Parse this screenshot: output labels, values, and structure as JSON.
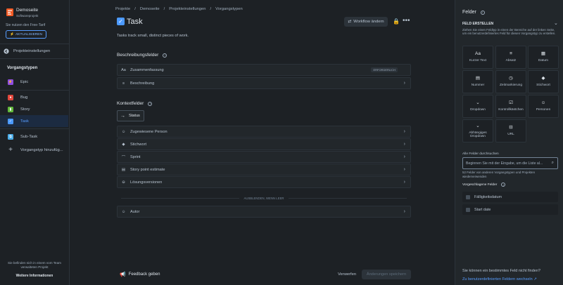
{
  "sidebar": {
    "project_name": "Demoseite",
    "project_type": "Softwareprojekt",
    "plan_notice": "Sie nutzen den Free-Tarif",
    "upgrade_label": "AKTUALISIEREN",
    "back_label": "Projekteinstellungen",
    "section_title": "Vorgangstypen",
    "items": [
      {
        "label": "Epic",
        "color": "#904ee2"
      },
      {
        "label": "Bug",
        "color": "#e2483d"
      },
      {
        "label": "Story",
        "color": "#63ba3c"
      },
      {
        "label": "Task",
        "color": "#4c9aff"
      },
      {
        "label": "Sub-Task",
        "color": "#4bade8"
      },
      {
        "label": "Vorgangstyp hinzufüg..."
      }
    ],
    "footer_text": "Sie befinden sich in einem vom Team verwalteten Projekt",
    "footer_link": "Weitere Informationen"
  },
  "breadcrumb": [
    "Projekte",
    "Demoseite",
    "Projekteinstellungen",
    "Vorgangstypen"
  ],
  "issue": {
    "title": "Task",
    "description": "Tasks track small, distinct pieces of work.",
    "workflow_button": "Workflow ändern"
  },
  "description_fields": {
    "title": "Beschreibungsfelder",
    "fields": [
      {
        "label": "Zusammenfassung",
        "badge": "ERFORDERLICH",
        "icon": "text-icon"
      },
      {
        "label": "Beschreibung",
        "icon": "paragraph-icon"
      }
    ]
  },
  "context_fields": {
    "title": "Kontextfelder",
    "status_label": "Status",
    "fields": [
      {
        "label": "Zugewiesene Person",
        "icon": "person-icon"
      },
      {
        "label": "Stichwort",
        "icon": "tag-icon"
      },
      {
        "label": "Sprint",
        "icon": "sprint-icon"
      },
      {
        "label": "Story point estimate",
        "icon": "number-icon"
      },
      {
        "label": "Lösungsversionen",
        "icon": "version-icon"
      }
    ],
    "hidden_divider": "AUSBLENDEN, WENN LEER",
    "hidden_fields": [
      {
        "label": "Autor",
        "icon": "person-icon"
      }
    ]
  },
  "footer": {
    "feedback": "Feedback geben",
    "discard": "Verwerfen",
    "save": "Änderungen speichern"
  },
  "right_panel": {
    "title": "Felder",
    "create_header": "FELD ERSTELLEN",
    "create_help": "Ziehen Sie einen Feldtyp in einen der Bereiche auf der linken Seite, um ein benutzerdefiniertes Feld für diesen Vorgangstyp zu erstellen.",
    "field_types": [
      {
        "label": "Kurzer Text",
        "icon": "Aa"
      },
      {
        "label": "Absatz",
        "icon": "≡"
      },
      {
        "label": "Datum",
        "icon": "▦"
      },
      {
        "label": "Nummer",
        "icon": "▤"
      },
      {
        "label": "Zeitmarkierung",
        "icon": "◷"
      },
      {
        "label": "Stichwort",
        "icon": "◆"
      },
      {
        "label": "Dropdown",
        "icon": "⌄"
      },
      {
        "label": "Kontrollkästchen",
        "icon": "☑"
      },
      {
        "label": "Personen",
        "icon": "☺"
      },
      {
        "label": "Abhängiges Dropdown",
        "icon": "⌄"
      },
      {
        "label": "URL",
        "icon": "⊟"
      }
    ],
    "all_fields_label": "Alle Felder durchsuchen",
    "search_placeholder": "Beginnen Sie mit der Eingabe, um die Liste al...",
    "search_help": "52 Felder von anderen Vorgangstypen und Projekten wiederverwenden",
    "suggested_title": "Vorgeschlagene Felder",
    "suggested": [
      "Fälligkeitsdatum",
      "Start date"
    ],
    "footer_question": "Sie können ein bestimmtes Feld nicht finden?",
    "footer_link": "Zu benutzerdefinierten Feldern wechseln"
  }
}
